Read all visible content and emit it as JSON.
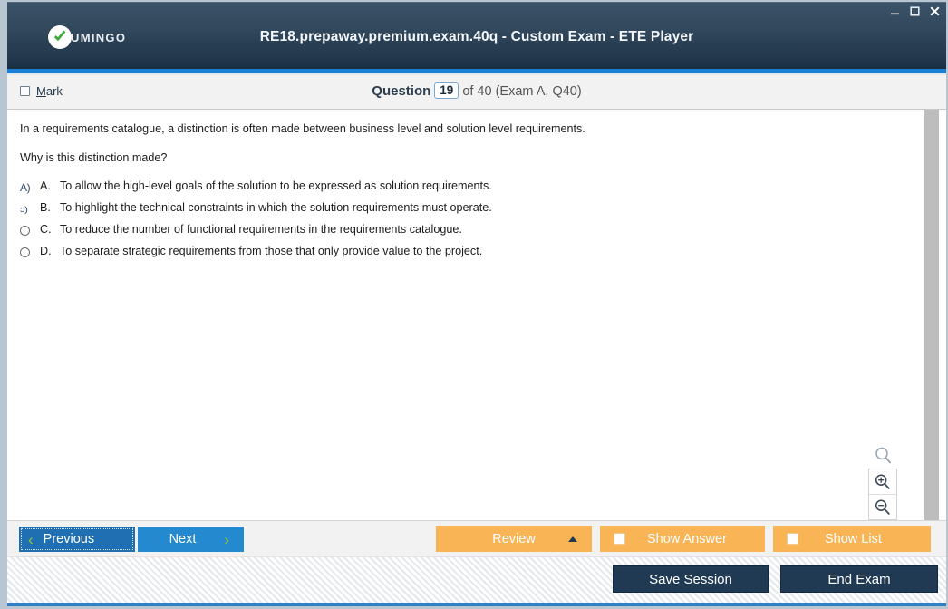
{
  "window": {
    "title": "RE18.prepaway.premium.exam.40q - Custom Exam - ETE Player",
    "brand_name": "UMINGO",
    "brand_icon": "check-circle-icon",
    "controls": {
      "minimize": "minimize-icon",
      "maximize": "maximize-icon",
      "close": "close-icon"
    },
    "accent_color": "#1b7fd4",
    "titlebar_color": "#22374c"
  },
  "header": {
    "mark_label": "Mark",
    "mark_accelerator": "M",
    "mark_checked": false,
    "question_word": "Question",
    "question_number": "19",
    "question_of": "of 40 (Exam A, Q40)"
  },
  "question": {
    "stem_line_1": "In a requirements catalogue, a distinction is often made between business level and solution level requirements.",
    "stem_line_2": "Why is this distinction made?",
    "options": [
      {
        "marker_glyph": "A)",
        "marker_type": "glitch-glyph",
        "letter": "A.",
        "text": "To allow the high-level goals of the solution to be expressed as solution requirements.",
        "selected": false
      },
      {
        "marker_glyph": "ɔ)",
        "marker_type": "glitch-glyph-stacked",
        "letter": "B.",
        "text": "To highlight the technical constraints in which the solution requirements must operate.",
        "selected": false
      },
      {
        "marker_glyph": "",
        "marker_type": "radio",
        "letter": "C.",
        "text": "To reduce the number of functional requirements in the requirements catalogue.",
        "selected": false
      },
      {
        "marker_glyph": "",
        "marker_type": "radio",
        "letter": "D.",
        "text": "To separate strategic requirements from those that only provide value to the project.",
        "selected": false
      }
    ]
  },
  "zoom_tools": {
    "magnifier": "magnifier-icon",
    "zoom_in": "zoom-in-icon",
    "zoom_out": "zoom-out-icon"
  },
  "toolbar": {
    "previous_label": "Previous",
    "previous_icon": "chevron-left-icon",
    "next_label": "Next",
    "next_icon": "chevron-right-icon",
    "review_label": "Review",
    "review_caret": "caret-up-icon",
    "show_answer_label": "Show Answer",
    "show_answer_checked": false,
    "show_list_label": "Show List",
    "show_list_checked": false,
    "accent_orange": "#f9b456",
    "primary_blue": "#2589d0"
  },
  "footer": {
    "save_session_label": "Save Session",
    "end_exam_label": "End Exam",
    "button_color": "#1f3a52"
  }
}
